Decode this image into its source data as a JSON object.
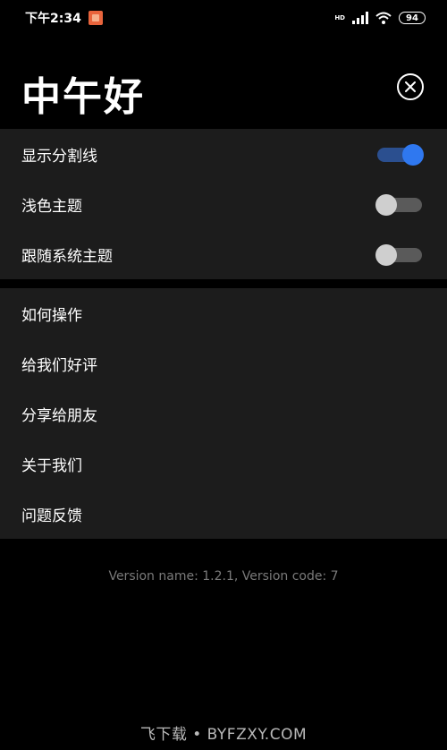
{
  "status_bar": {
    "time": "下午2:34",
    "network_label": "HD",
    "battery": "94"
  },
  "header": {
    "greeting": "中午好"
  },
  "settings": [
    {
      "label": "显示分割线",
      "on": true
    },
    {
      "label": "浅色主题",
      "on": false
    },
    {
      "label": "跟随系统主题",
      "on": false
    }
  ],
  "links": [
    {
      "label": "如何操作"
    },
    {
      "label": "给我们好评"
    },
    {
      "label": "分享给朋友"
    },
    {
      "label": "关于我们"
    },
    {
      "label": "问题反馈"
    }
  ],
  "version_text": "Version name: 1.2.1, Version code: 7",
  "watermark": "飞下载 • BYFZXY.COM",
  "colors": {
    "background": "#000000",
    "card": "#1c1c1c",
    "toggle_on_thumb": "#2f78f0",
    "toggle_on_track": "#2b4f8f",
    "toggle_off_thumb": "#cfcfcf",
    "toggle_off_track": "#5a5a5a"
  }
}
